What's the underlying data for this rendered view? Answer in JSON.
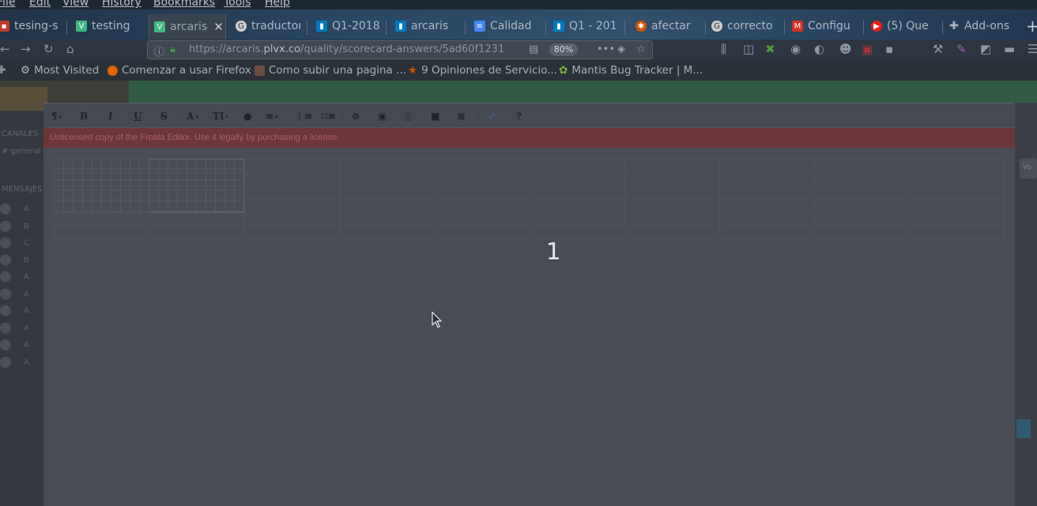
{
  "menu": [
    "File",
    "Edit",
    "View",
    "History",
    "Bookmarks",
    "Tools",
    "Help"
  ],
  "tabs": [
    {
      "label": "tesing-s",
      "icon": "trello-icon",
      "color": "#c0392b",
      "active": false
    },
    {
      "label": "testing",
      "icon": "vue-icon",
      "color": "#41b883",
      "active": false
    },
    {
      "label": "arcaris",
      "icon": "vue-icon",
      "color": "#41b883",
      "active": true
    },
    {
      "label": "traductor",
      "icon": "google-icon",
      "color": "#cccccc",
      "active": false
    },
    {
      "label": "Q1-2018",
      "icon": "trello-icon",
      "color": "#0079bf",
      "active": false
    },
    {
      "label": "arcaris",
      "icon": "trello-icon",
      "color": "#0079bf",
      "active": false
    },
    {
      "label": "Calidad",
      "icon": "docs-icon",
      "color": "#4285f4",
      "active": false
    },
    {
      "label": "Q1 - 201",
      "icon": "trello-icon",
      "color": "#0079bf",
      "active": false
    },
    {
      "label": "afectar",
      "icon": "scrum-icon",
      "color": "#d35400",
      "active": false
    },
    {
      "label": "correcto",
      "icon": "google-icon",
      "color": "#cccccc",
      "active": false
    },
    {
      "label": "Configu",
      "icon": "gmail-icon",
      "color": "#d93025",
      "active": false
    },
    {
      "label": "(5) Que",
      "icon": "youtube-icon",
      "color": "#e62117",
      "active": false
    },
    {
      "label": "Add-ons",
      "icon": "puzzle-icon",
      "color": "#aab4bf",
      "active": false
    }
  ],
  "address": {
    "prefix": "https://arcaris.",
    "domain": "plvx.co",
    "path": "/quality/scorecard-answers/5ad60f1231",
    "zoom": "80%"
  },
  "bookmarks": [
    {
      "label": "Most Visited",
      "icon": "gear-icon",
      "color": "#aab4bf"
    },
    {
      "label": "Comenzar a usar Firefox",
      "icon": "firefox-icon",
      "color": "#e66000"
    },
    {
      "label": "Como subir una pagina ...",
      "icon": "page-icon",
      "color": "#6d4c41"
    },
    {
      "label": "9 Opiniones de Servicio...",
      "icon": "star-icon",
      "color": "#d35400"
    },
    {
      "label": "Mantis Bug Tracker | M...",
      "icon": "mantis-icon",
      "color": "#7cb342"
    }
  ],
  "sidebar": {
    "section1": "CANALES",
    "section1_item": "# general",
    "section2": "MENSAJES",
    "items": [
      "A",
      "B",
      "C",
      "B",
      "A",
      "A",
      "A",
      "A",
      "A",
      "A"
    ]
  },
  "right": {
    "button": "Vo"
  },
  "editor": {
    "license_text": "Unlicensed copy of the Froala Editor. Use it legally by purchasing a license.",
    "toolbar": [
      "paragraph-format",
      "bold",
      "italic",
      "underline",
      "strikethrough",
      "font-family",
      "font-size",
      "color",
      "align",
      "ordered-list",
      "unordered-list",
      "link",
      "image",
      "file",
      "video",
      "table",
      "fullscreen",
      "help"
    ],
    "grid_columns": 10,
    "grid_rows": 5
  },
  "counter": "1"
}
